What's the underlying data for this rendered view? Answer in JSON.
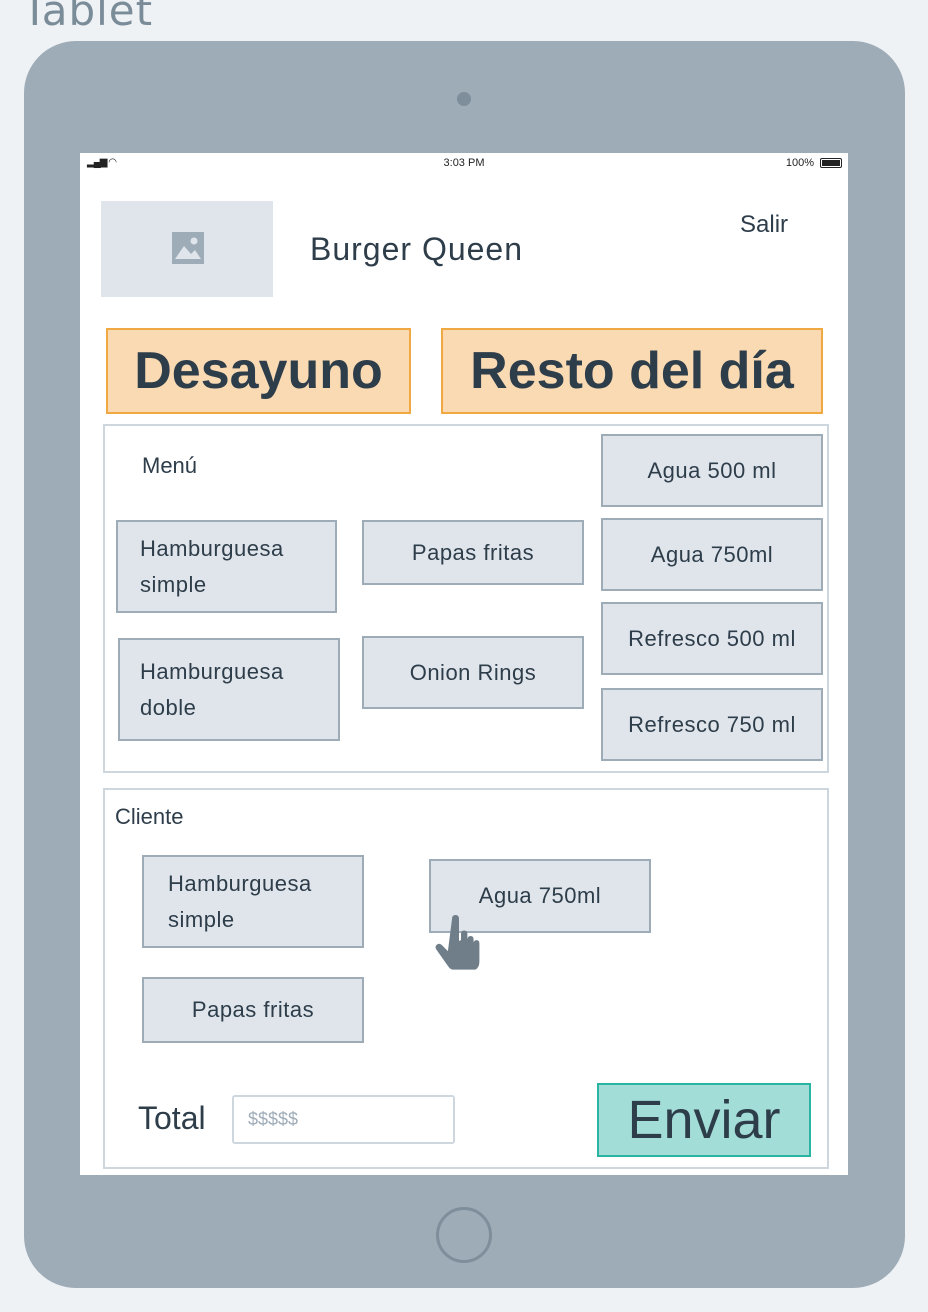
{
  "frame": {
    "label": "Tablet"
  },
  "status_bar": {
    "time": "3:03 PM",
    "battery": "100%"
  },
  "header": {
    "brand": "Burger Queen",
    "logout": "Salir"
  },
  "categories": [
    {
      "label": "Desayuno"
    },
    {
      "label": "Resto del día"
    }
  ],
  "menu": {
    "title": "Menú",
    "food_items": [
      {
        "label": "Hamburguesa simple"
      },
      {
        "label": "Papas fritas"
      },
      {
        "label": "Hamburguesa doble"
      },
      {
        "label": "Onion Rings"
      }
    ],
    "drinks": [
      {
        "label": "Agua 500 ml"
      },
      {
        "label": "Agua 750ml"
      },
      {
        "label": "Refresco 500 ml"
      },
      {
        "label": "Refresco 750 ml"
      }
    ]
  },
  "order": {
    "title": "Cliente",
    "items": [
      {
        "label": "Hamburguesa simple"
      },
      {
        "label": "Agua 750ml"
      },
      {
        "label": "Papas fritas"
      }
    ],
    "total_label": "Total",
    "total_placeholder": "$$$$$",
    "send_label": "Enviar"
  },
  "icons": {
    "logo": "image-placeholder-icon",
    "cursor": "hand-pointer-icon"
  },
  "colors": {
    "tablet_body": "#9eacb8",
    "category_fill": "#f9dab3",
    "category_border": "#f0a843",
    "send_fill": "#a3ddd8",
    "send_border": "#2bb3a3",
    "item_fill": "#dfe5eb"
  }
}
